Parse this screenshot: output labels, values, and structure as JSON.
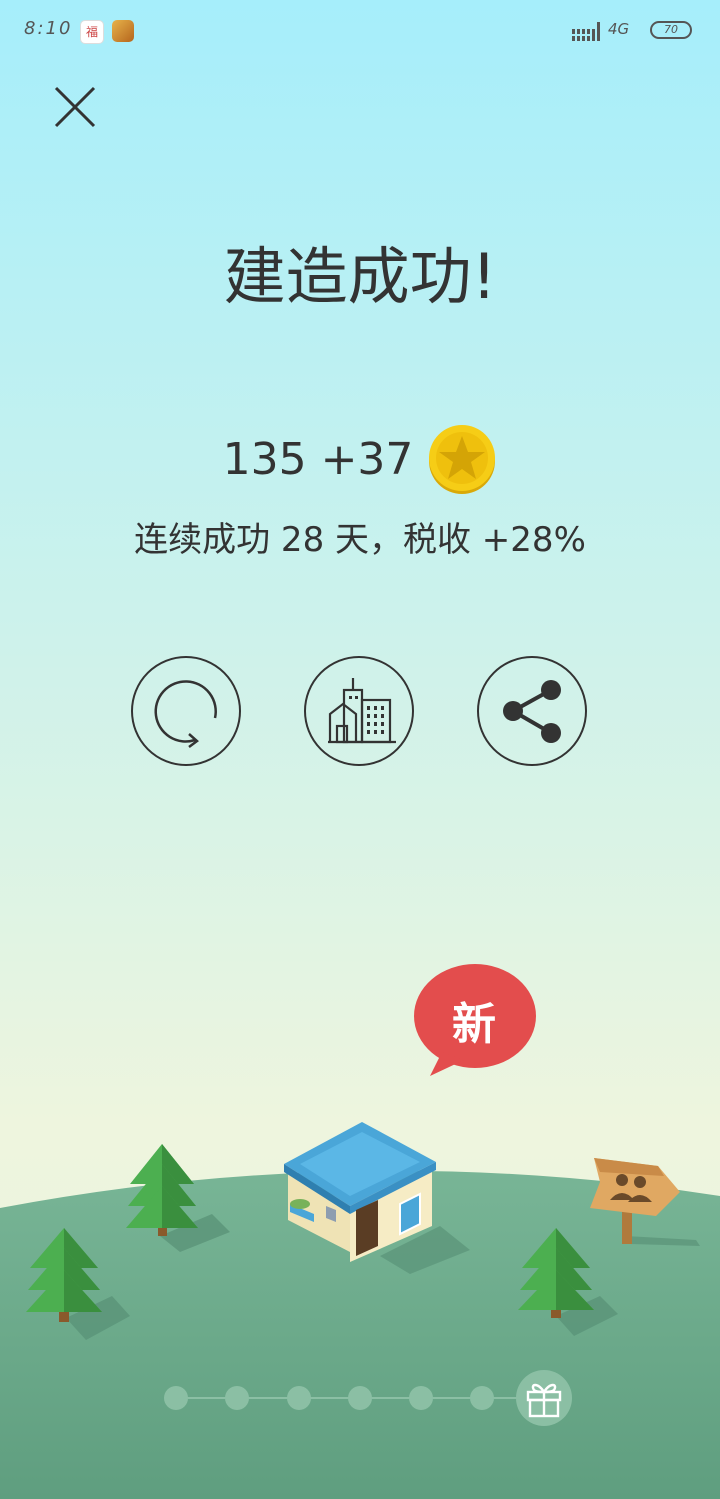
{
  "status_bar": {
    "time": "8:10",
    "network": "4G",
    "battery": "70",
    "app_icon_1_label": "福"
  },
  "result": {
    "title": "建造成功!",
    "coins_total": "135",
    "coins_gain": "+37",
    "streak_text": "连续成功 28 天，税收 +28%"
  },
  "actions": [
    {
      "name": "retry",
      "icon": "refresh-icon"
    },
    {
      "name": "city",
      "icon": "city-buildings-icon"
    },
    {
      "name": "share",
      "icon": "share-icon"
    }
  ],
  "new_badge": {
    "label": "新"
  },
  "progress": {
    "total_steps": 7,
    "current_step": 7,
    "final_icon": "gift-icon"
  },
  "colors": {
    "sky_top": "#a6eefb",
    "hill": "#6fae90",
    "badge": "#e34d4d",
    "coin": "#f2c20e",
    "roof": "#4aa6d8"
  }
}
